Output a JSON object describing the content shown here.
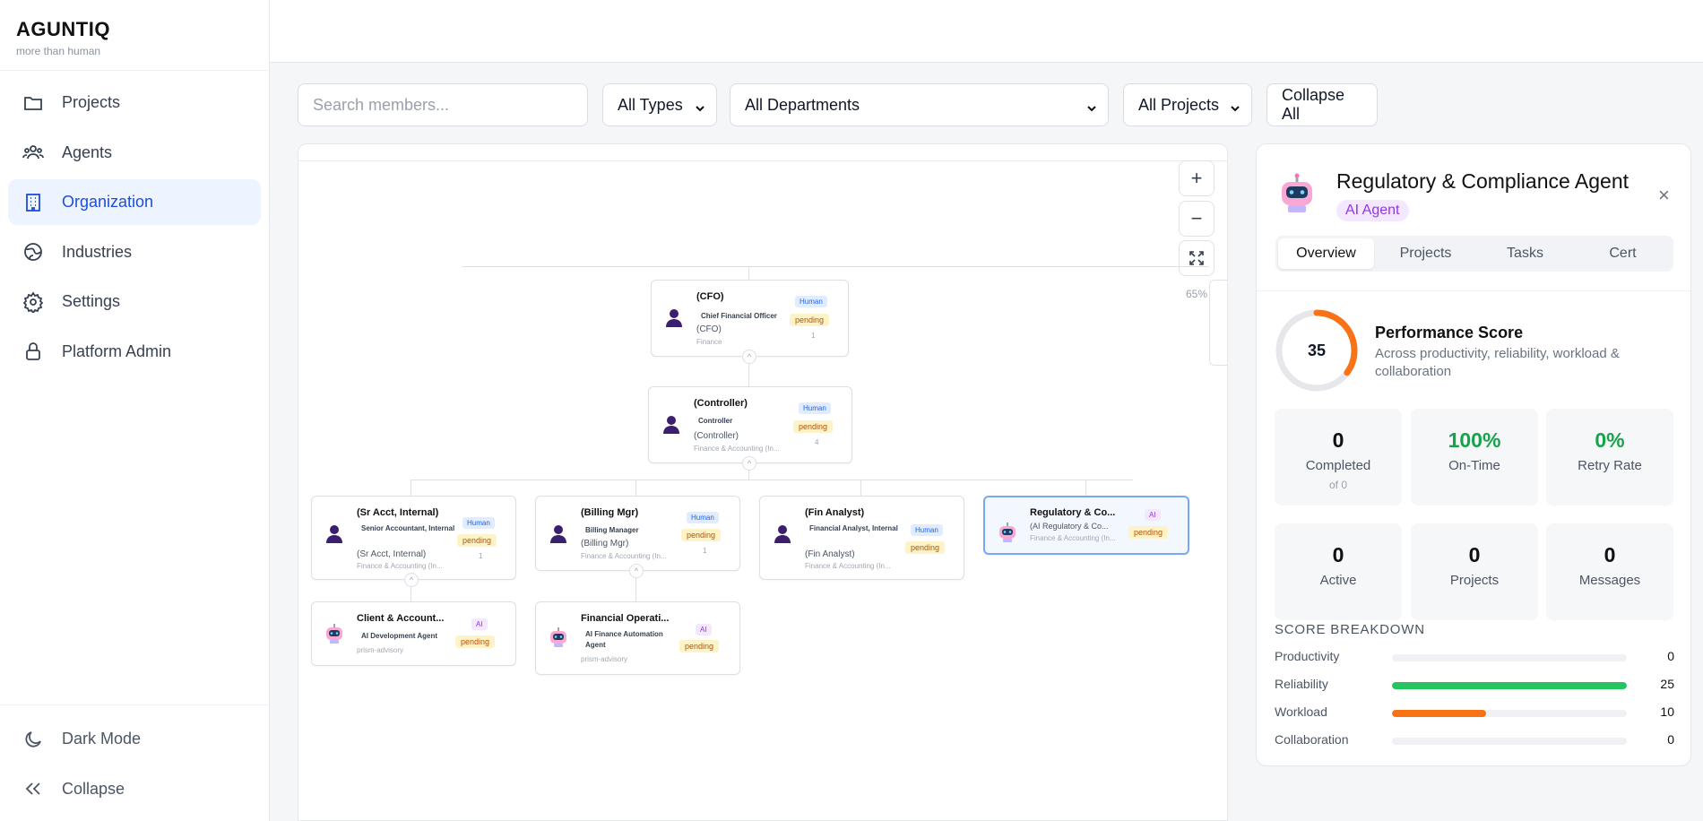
{
  "brand": {
    "name": "AGUNTIQ",
    "tagline": "more than human"
  },
  "nav": [
    {
      "label": "Projects",
      "icon": "folder-icon"
    },
    {
      "label": "Agents",
      "icon": "users-icon"
    },
    {
      "label": "Organization",
      "icon": "building-icon",
      "active": true
    },
    {
      "label": "Industries",
      "icon": "globe-icon"
    },
    {
      "label": "Settings",
      "icon": "gear-icon"
    },
    {
      "label": "Platform Admin",
      "icon": "lock-icon"
    }
  ],
  "nav_bottom": [
    {
      "label": "Dark Mode",
      "icon": "moon-icon"
    },
    {
      "label": "Collapse",
      "icon": "chevrons-left-icon"
    }
  ],
  "filters": {
    "search_placeholder": "Search members...",
    "types": "All Types",
    "departments": "All Departments",
    "projects": "All Projects",
    "collapse_all": "Collapse All"
  },
  "chart": {
    "zoom_in": "+",
    "zoom_out": "−",
    "zoom_level": "65%",
    "nodes": {
      "cfo": {
        "title": "(CFO)",
        "role": "Chief Financial Officer",
        "code": "(CFO)",
        "dept": "Finance",
        "type": "Human",
        "status": "pending",
        "count": "1"
      },
      "controller": {
        "title": "(Controller)",
        "role": "Controller",
        "code": "(Controller)",
        "dept": "Finance & Accounting (In...",
        "type": "Human",
        "status": "pending",
        "count": "4"
      },
      "sr_acct": {
        "title": "(Sr Acct, Internal)",
        "role": "Senior Accountant, Internal",
        "code": "(Sr Acct, Internal)",
        "dept": "Finance & Accounting (In...",
        "type": "Human",
        "status": "pending",
        "count": "1"
      },
      "billing": {
        "title": "(Billing Mgr)",
        "role": "Billing Manager",
        "code": "(Billing Mgr)",
        "dept": "Finance & Accounting (In...",
        "type": "Human",
        "status": "pending",
        "count": "1"
      },
      "fin_analyst": {
        "title": "(Fin Analyst)",
        "role": "Financial Analyst, Internal",
        "code": "(Fin Analyst)",
        "dept": "Finance & Accounting (In...",
        "type": "Human",
        "status": "pending"
      },
      "regulatory": {
        "title": "Regulatory & Co...",
        "code": "(AI Regulatory & Co...",
        "dept": "Finance & Accounting (In...",
        "type": "AI",
        "status": "pending"
      },
      "client": {
        "title": "Client & Account...",
        "role": "AI Development Agent",
        "dept": "prism-advisory",
        "type": "AI",
        "status": "pending"
      },
      "finops": {
        "title": "Financial Operati...",
        "role": "AI Finance Automation Agent",
        "dept": "prism-advisory",
        "type": "AI",
        "status": "pending"
      }
    }
  },
  "panel": {
    "title": "Regulatory & Compliance Agent",
    "chip": "AI Agent",
    "close": "×",
    "tabs": [
      "Overview",
      "Projects",
      "Tasks",
      "Cert"
    ],
    "score": 35,
    "perf_title": "Performance Score",
    "perf_sub": "Across productivity, reliability, workload & collaboration",
    "stats": [
      {
        "value": "0",
        "label": "Completed",
        "sub": "of 0"
      },
      {
        "value": "100%",
        "label": "On-Time",
        "color": "#16a34a"
      },
      {
        "value": "0%",
        "label": "Retry Rate",
        "color": "#16a34a"
      },
      {
        "value": "0",
        "label": "Active"
      },
      {
        "value": "0",
        "label": "Projects"
      },
      {
        "value": "0",
        "label": "Messages"
      }
    ],
    "breakdown_title": "SCORE BREAKDOWN",
    "breakdown": [
      {
        "label": "Productivity",
        "value": 0,
        "max": 25,
        "color": "#22c55e"
      },
      {
        "label": "Reliability",
        "value": 25,
        "max": 25,
        "color": "#22c55e"
      },
      {
        "label": "Workload",
        "value": 10,
        "max": 25,
        "color": "#f97316"
      },
      {
        "label": "Collaboration",
        "value": 0,
        "max": 25,
        "color": "#22c55e"
      }
    ]
  }
}
